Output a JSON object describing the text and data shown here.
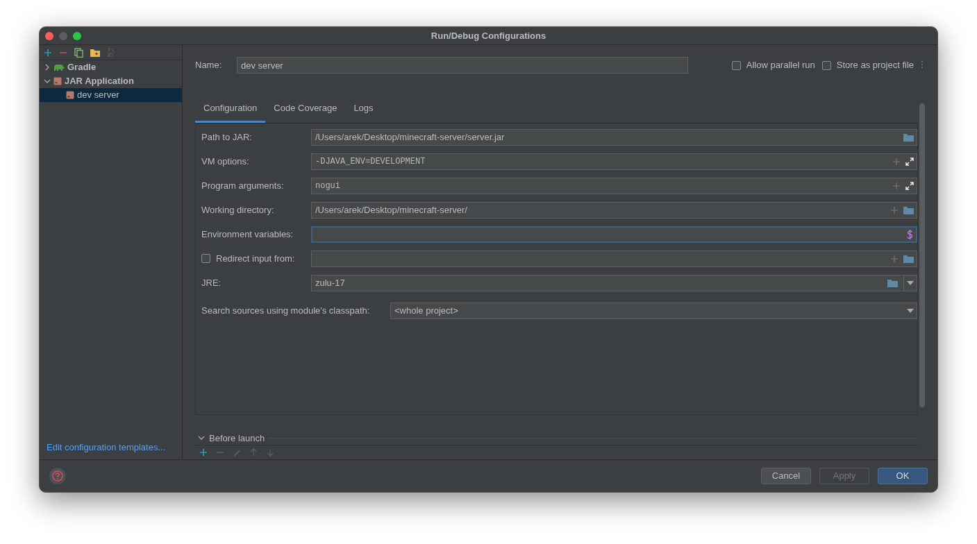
{
  "window": {
    "title": "Run/Debug Configurations"
  },
  "sidebar": {
    "toolbar": [
      {
        "kind": "add",
        "disabled": false
      },
      {
        "kind": "remove",
        "disabled": false
      },
      {
        "kind": "copy",
        "disabled": false
      },
      {
        "kind": "folder",
        "disabled": false
      },
      {
        "kind": "sort",
        "disabled": true
      }
    ],
    "tree": [
      {
        "label": "Gradle",
        "kind": "gradle",
        "expanded": false,
        "selected": false
      },
      {
        "label": "JAR Application",
        "kind": "jar",
        "expanded": true,
        "selected": false,
        "children": [
          {
            "label": "dev server",
            "kind": "jar",
            "selected": true
          }
        ]
      }
    ],
    "templates_link": "Edit configuration templates..."
  },
  "name": {
    "label": "Name:",
    "value": "dev server"
  },
  "options": [
    {
      "label": "Allow parallel run",
      "checked": false
    },
    {
      "label": "Store as project file",
      "checked": false
    }
  ],
  "tabs": [
    {
      "label": "Configuration",
      "selected": true
    },
    {
      "label": "Code Coverage",
      "selected": false
    },
    {
      "label": "Logs",
      "selected": false
    }
  ],
  "fields": [
    {
      "label": "Path to JAR:",
      "kind": "file",
      "value": "/Users/arek/Desktop/minecraft-server/server.jar"
    },
    {
      "label": "VM options:",
      "kind": "options",
      "value": "-DJAVA_ENV=DEVELOPMENT"
    },
    {
      "label": "Program arguments:",
      "kind": "options",
      "value": "nogui"
    },
    {
      "label": "Working directory:",
      "kind": "directory",
      "value": "/Users/arek/Desktop/minecraft-server/"
    },
    {
      "label": "Environment variables:",
      "kind": "env",
      "focused": true
    },
    {
      "label": "Redirect input from:",
      "kind": "redirect",
      "checked": false
    },
    {
      "label": "JRE:",
      "kind": "jre",
      "value": "zulu-17"
    },
    {
      "label": "Search sources using module's classpath:",
      "kind": "select",
      "value": "<whole project>"
    }
  ],
  "before_launch": {
    "title": "Before launch",
    "expanded": true,
    "toolbar": [
      {
        "kind": "add",
        "disabled": false
      },
      {
        "kind": "remove",
        "disabled": true
      },
      {
        "kind": "edit",
        "disabled": true
      },
      {
        "kind": "up",
        "disabled": true
      },
      {
        "kind": "down",
        "disabled": true
      }
    ]
  },
  "buttons": [
    {
      "label": "Cancel",
      "kind": "default",
      "disabled": false
    },
    {
      "label": "Apply",
      "kind": "default",
      "disabled": true
    },
    {
      "label": "OK",
      "kind": "primary",
      "disabled": false
    }
  ]
}
